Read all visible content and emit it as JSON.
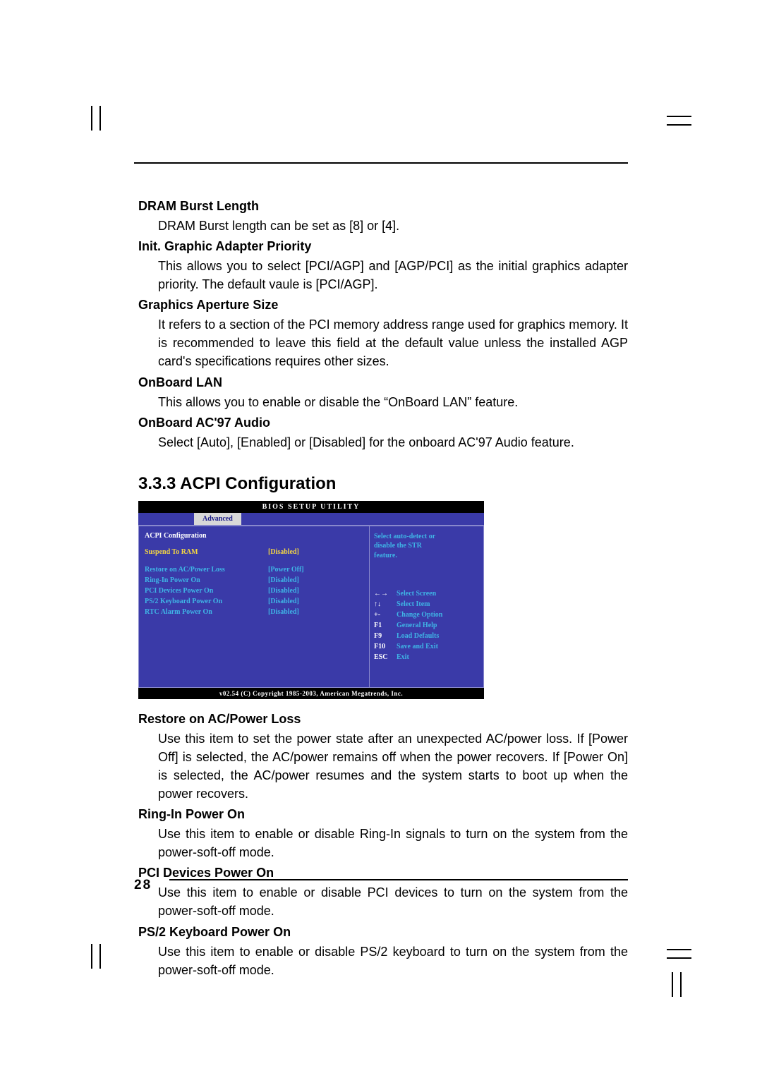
{
  "items": [
    {
      "title": "DRAM Burst Length",
      "desc": "DRAM Burst length can be set as [8] or [4]."
    },
    {
      "title": "Init. Graphic Adapter Priority",
      "desc": "This allows you to select [PCI/AGP] and [AGP/PCI] as the initial graphics adapter priority. The default vaule is [PCI/AGP]."
    },
    {
      "title": "Graphics Aperture Size",
      "desc": "It refers to a section of the PCI memory address range used for graphics memory. It is recommended to leave this field at the default value unless the installed AGP card's specifications requires other sizes."
    },
    {
      "title": "OnBoard LAN",
      "desc": "This allows you to enable or disable the “OnBoard LAN” feature."
    },
    {
      "title": "OnBoard AC'97 Audio",
      "desc": "Select [Auto], [Enabled] or [Disabled] for the onboard AC'97 Audio feature."
    }
  ],
  "section_heading": "3.3.3 ACPI Configuration",
  "bios": {
    "title": "BIOS SETUP UTILITY",
    "tab": "Advanced",
    "panel_title": "ACPI Configuration",
    "selected": {
      "label": "Suspend To RAM",
      "value": "[Disabled]"
    },
    "rows": [
      {
        "label": "Restore on AC/Power Loss",
        "value": "[Power Off]"
      },
      {
        "label": "Ring-In Power On",
        "value": "[Disabled]"
      },
      {
        "label": "PCI Devices Power On",
        "value": "[Disabled]"
      },
      {
        "label": "PS/2 Keyboard Power On",
        "value": "[Disabled]"
      },
      {
        "label": "RTC Alarm Power On",
        "value": "[Disabled]"
      }
    ],
    "help1": "Select auto-detect or",
    "help2": "disable the STR",
    "help3": "feature.",
    "nav": [
      {
        "key": "←→",
        "txt": "Select Screen"
      },
      {
        "key": "↑↓",
        "txt": "Select Item"
      },
      {
        "key": "+-",
        "txt": "Change Option"
      },
      {
        "key": "F1",
        "txt": "General Help"
      },
      {
        "key": "F9",
        "txt": "Load Defaults"
      },
      {
        "key": "F10",
        "txt": "Save and Exit"
      },
      {
        "key": "ESC",
        "txt": "Exit"
      }
    ],
    "copyright": "v02.54 (C) Copyright 1985-2003, American Megatrends, Inc."
  },
  "items2": [
    {
      "title": "Restore on AC/Power Loss",
      "desc": "Use this item to set the power state after an unexpected AC/power loss. If [Power Off] is selected, the AC/power remains off when the power recovers. If [Power On] is selected, the AC/power resumes and the system starts to boot up when the power recovers."
    },
    {
      "title": "Ring-In Power On",
      "desc": "Use this item to enable or disable Ring-In signals to turn on the system from the power-soft-off mode."
    },
    {
      "title": "PCI Devices Power On",
      "desc": "Use this item to enable or disable PCI devices to turn on the system from the power-soft-off mode."
    },
    {
      "title": "PS/2 Keyboard Power On",
      "desc": "Use this item to enable or disable PS/2 keyboard to turn on the system from the power-soft-off mode."
    }
  ],
  "page_number": "28"
}
